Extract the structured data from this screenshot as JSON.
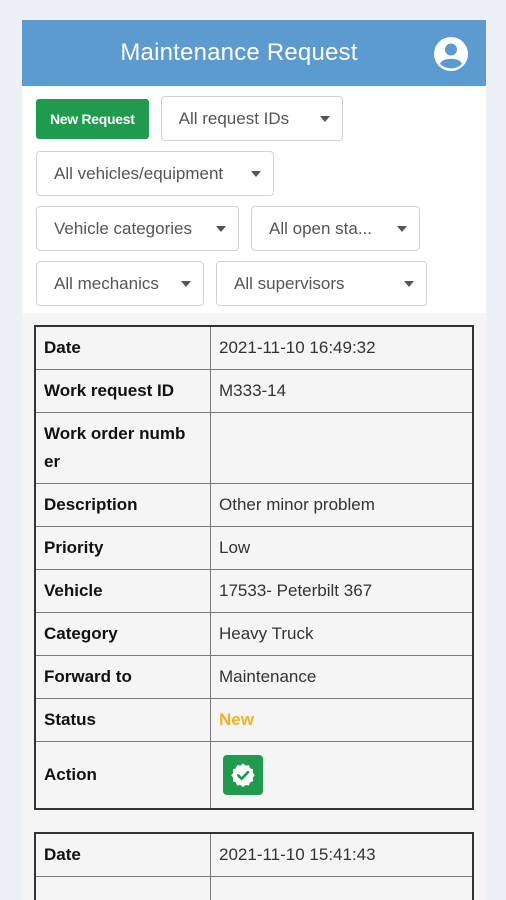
{
  "header": {
    "title": "Maintenance Request"
  },
  "filters": {
    "new_request_label": "New Request",
    "request_ids": "All request IDs",
    "vehicles": "All vehicles/equipment",
    "categories": "Vehicle categories",
    "open_status": "All open sta...",
    "mechanics": "All mechanics",
    "supervisors": "All supervisors"
  },
  "labels": {
    "date": "Date",
    "work_request_id": "Work request ID",
    "work_order_number": "Work order numb er",
    "description": "Description",
    "priority": "Priority",
    "vehicle": "Vehicle",
    "category": "Category",
    "forward_to": "Forward to",
    "status": "Status",
    "action": "Action"
  },
  "records": [
    {
      "date": "2021-11-10 16:49:32",
      "work_request_id": "M333-14",
      "work_order_number": "",
      "description": "Other minor problem",
      "priority": "Low",
      "vehicle": "17533- Peterbilt 367",
      "category": "Heavy Truck",
      "forward_to": "Maintenance",
      "status": "New"
    },
    {
      "date": "2021-11-10 15:41:43"
    }
  ],
  "colors": {
    "header_bg": "#5b9bd0",
    "new_button": "#1e9b4d",
    "status_new": "#f2b51d"
  }
}
